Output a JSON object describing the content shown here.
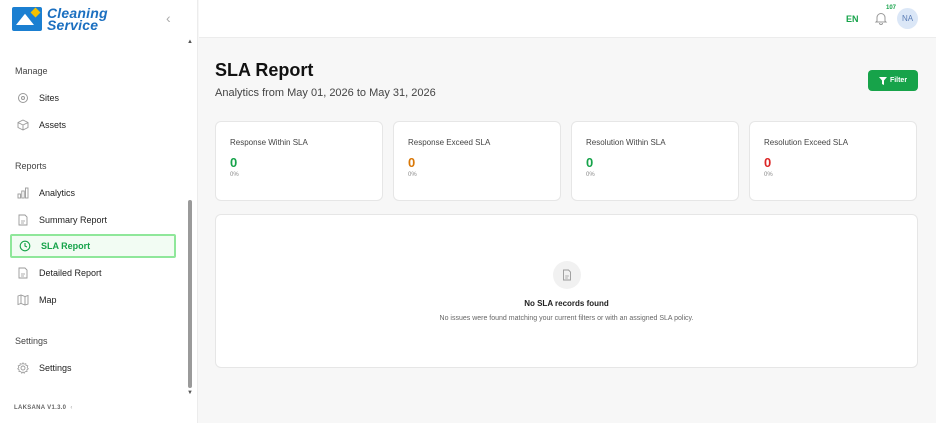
{
  "brand": {
    "line1": "Cleaning",
    "line2": "Service"
  },
  "sidebar": {
    "sections": [
      {
        "title": "Manage"
      },
      {
        "title": "Reports"
      },
      {
        "title": "Settings"
      }
    ],
    "items": [
      {
        "label": "Sites",
        "icon": "location-pin-icon"
      },
      {
        "label": "Assets",
        "icon": "cube-icon"
      },
      {
        "label": "Analytics",
        "icon": "bar-chart-icon"
      },
      {
        "label": "Summary Report",
        "icon": "document-icon"
      },
      {
        "label": "SLA Report",
        "icon": "clock-icon",
        "active": true
      },
      {
        "label": "Detailed Report",
        "icon": "document-icon"
      },
      {
        "label": "Map",
        "icon": "map-icon"
      },
      {
        "label": "Settings",
        "icon": "gear-icon"
      }
    ],
    "version": "LAKSANA V1.3.0"
  },
  "header": {
    "language": "EN",
    "notification_count": "107",
    "avatar_initials": "NA"
  },
  "main": {
    "title": "SLA Report",
    "subtitle": "Analytics from May 01, 2026 to May 31, 2026",
    "filter_label": "Filter",
    "cards": [
      {
        "label": "Response Within SLA",
        "value": "0",
        "percent": "0%",
        "color": "#16a34a"
      },
      {
        "label": "Response Exceed SLA",
        "value": "0",
        "percent": "0%",
        "color": "#d97706"
      },
      {
        "label": "Resolution Within SLA",
        "value": "0",
        "percent": "0%",
        "color": "#16a34a"
      },
      {
        "label": "Resolution Exceed SLA",
        "value": "0",
        "percent": "0%",
        "color": "#dc2626"
      }
    ],
    "empty": {
      "title": "No SLA records found",
      "description": "No issues were found matching your current filters or with an assigned SLA policy."
    }
  },
  "colors": {
    "accent": "#16a34a",
    "brand": "#1b6fc0"
  }
}
